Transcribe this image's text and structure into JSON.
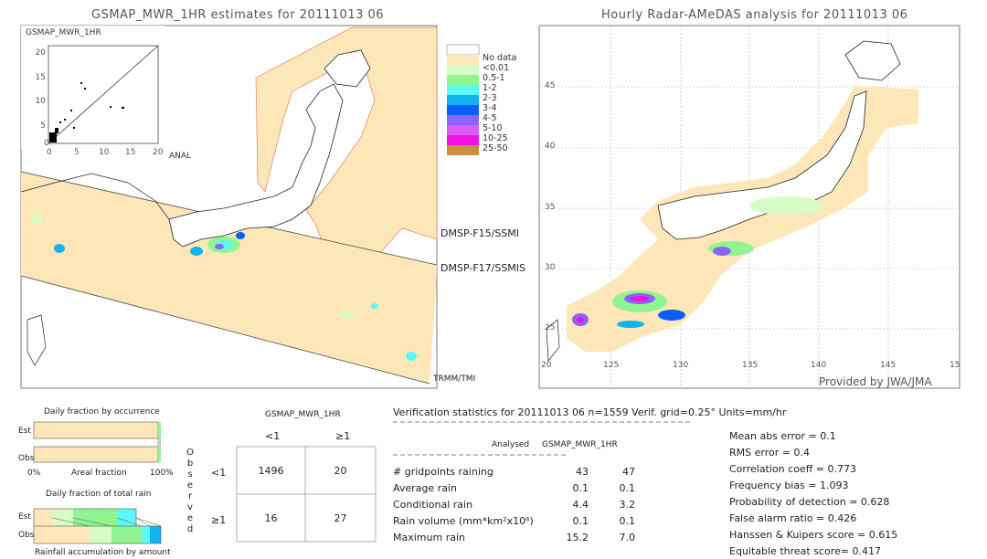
{
  "left_map": {
    "title": "GSMAP_MWR_1HR estimates for 20111013 06",
    "inset": {
      "ylabel": "GSMAP_MWR_1HR",
      "xlabel": "ANAL",
      "yticks": [
        "20",
        "15",
        "10",
        "5",
        "0"
      ],
      "xticks": [
        "0",
        "5",
        "10",
        "15",
        "20"
      ]
    },
    "swath_labels": [
      "DMSP-F15/SSMI",
      "DMSP-F17/SSMIS",
      "TRMM/TMI"
    ]
  },
  "legend": {
    "items": [
      {
        "label": "No data",
        "color": "#fde6b8"
      },
      {
        "label": "<0.01",
        "color": "#d8fcc6"
      },
      {
        "label": "0.5-1",
        "color": "#90f590"
      },
      {
        "label": "1-2",
        "color": "#5cf8f8"
      },
      {
        "label": "2-3",
        "color": "#10b4f0"
      },
      {
        "label": "3-4",
        "color": "#0a5ef5"
      },
      {
        "label": "4-5",
        "color": "#8a64f5"
      },
      {
        "label": "5-10",
        "color": "#da5cf5"
      },
      {
        "label": "10-25",
        "color": "#f010e0"
      },
      {
        "label": "25-50",
        "color": "#c89040"
      }
    ]
  },
  "right_map": {
    "title": "Hourly Radar-AMeDAS analysis for 20111013 06",
    "lat_labels": [
      "45",
      "40",
      "35",
      "30",
      "25",
      "20"
    ],
    "lon_labels": [
      "125",
      "130",
      "135",
      "140",
      "145",
      "15"
    ],
    "credit": "Provided by JWA/JMA"
  },
  "occurrence": {
    "title": "Daily fraction by occurrence",
    "est": "Est",
    "obs": "Obs",
    "x_left": "0%",
    "x_mid": "Areal fraction",
    "x_right": "100%"
  },
  "total_rain": {
    "title": "Daily fraction of total rain",
    "est": "Est",
    "obs": "Obs",
    "footer": "Rainfall accumulation by amount"
  },
  "contingency": {
    "title": "GSMAP_MWR_1HR",
    "col_headers": [
      "<1",
      "≥1"
    ],
    "row_headers": [
      "<1",
      "≥1"
    ],
    "observed_label": [
      "O",
      "b",
      "s",
      "e",
      "r",
      "v",
      "e",
      "d"
    ],
    "cells": [
      [
        "1496",
        "20"
      ],
      [
        "16",
        "27"
      ]
    ]
  },
  "stats": {
    "header": "Verification statistics for 20111013 06   n=1559   Verif. grid=0.25°   Units=mm/hr",
    "col_analysed": "Analysed",
    "col_gsmap": "GSMAP_MWR_1HR",
    "rows": [
      {
        "label": "# gridpoints raining",
        "analysed": "43",
        "gsmap": "47"
      },
      {
        "label": "Average rain",
        "analysed": "0.1",
        "gsmap": "0.1"
      },
      {
        "label": "Conditional rain",
        "analysed": "4.4",
        "gsmap": "3.2"
      },
      {
        "label": "Rain volume (mm*km²x10⁶)",
        "analysed": "0.1",
        "gsmap": "0.1"
      },
      {
        "label": "Maximum rain",
        "analysed": "15.2",
        "gsmap": "7.0"
      }
    ],
    "scores": [
      "Mean abs error = 0.1",
      "RMS error = 0.4",
      "Correlation coeff = 0.773",
      "Frequency bias = 1.093",
      "Probability of detection = 0.628",
      "False alarm ratio = 0.426",
      "Hanssen & Kuipers score = 0.615",
      "Equitable threat score= 0.417"
    ]
  }
}
